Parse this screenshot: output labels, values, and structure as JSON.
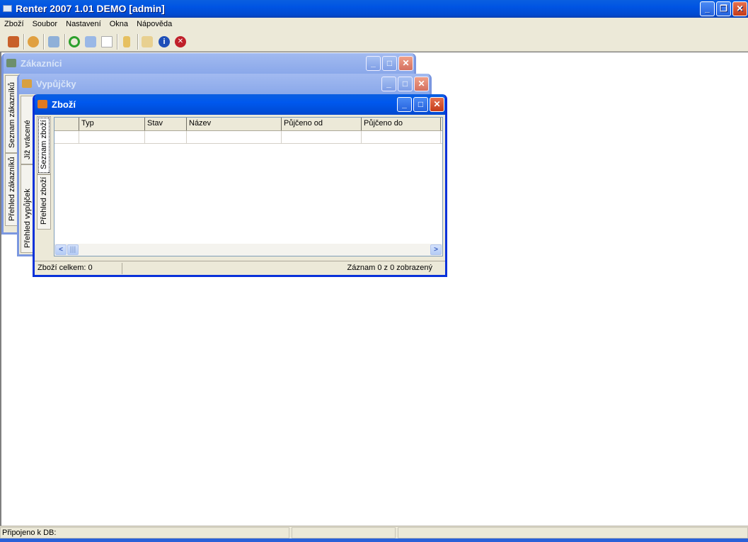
{
  "app": {
    "title": "Renter 2007 1.01 DEMO [admin]"
  },
  "menu": [
    "Zboží",
    "Soubor",
    "Nastavení",
    "Okna",
    "Nápověda"
  ],
  "toolbar": [
    "new-item-icon",
    "user-icon",
    "customers-icon",
    "refresh-icon",
    "edit-icon",
    "blank-icon",
    "books-icon",
    "tools-icon",
    "info-icon",
    "exit-icon"
  ],
  "windows": {
    "zakaznici": {
      "title": "Zákazníci",
      "tabs": [
        "Seznam zákazníků",
        "Přehled zákazníků"
      ]
    },
    "vypujcky": {
      "title": "Vypůjčky",
      "tabs": [
        "Již vrácené",
        "Přehled vypůjček"
      ]
    },
    "zbozi": {
      "title": "Zboží",
      "tabs": [
        "Seznam zboží",
        "Přehled zboží"
      ],
      "columns": [
        "",
        "Typ",
        "Stav",
        "Název",
        "Půjčeno od",
        "Půjčeno do"
      ],
      "status_left": "Zboží celkem: 0",
      "status_right": "Záznam 0 z 0 zobrazený"
    }
  },
  "status": {
    "db": "Připojeno k DB:"
  },
  "colors": {
    "title": "#0054e3",
    "chrome": "#ece9d8"
  }
}
